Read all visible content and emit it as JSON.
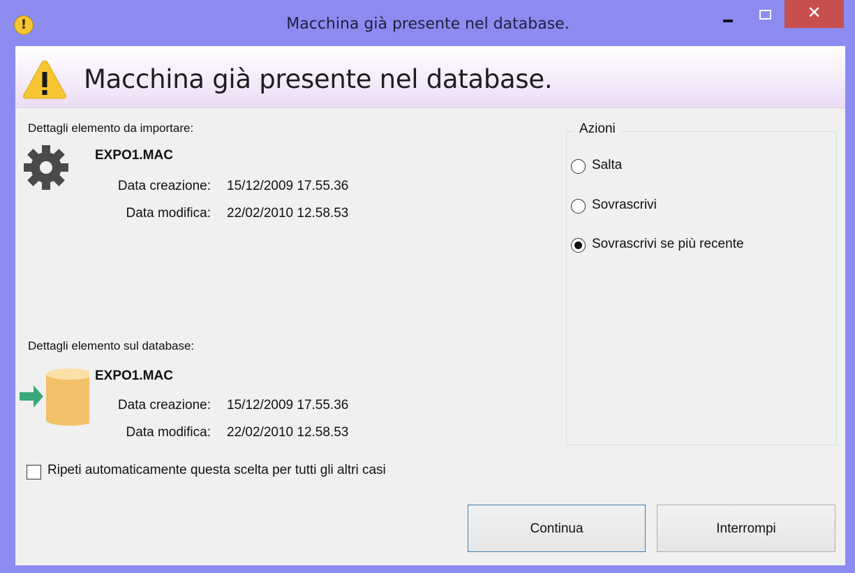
{
  "window": {
    "title": "Macchina già presente nel database.",
    "title_icon": "warning-circle-icon",
    "accent_color": "#8b8bf0",
    "close_color": "#c7504f"
  },
  "banner": {
    "title": "Macchina già presente nel database.",
    "icon": "warning-triangle-icon"
  },
  "import_section": {
    "label": "Dettagli elemento da importare:",
    "icon": "gear-icon",
    "name": "EXPO1.MAC",
    "created_label": "Data creazione:",
    "created_value": "15/12/2009 17.55.36",
    "modified_label": "Data modifica:",
    "modified_value": "22/02/2010 12.58.53"
  },
  "database_section": {
    "label": "Dettagli elemento sul database:",
    "icon": "database-import-icon",
    "name": "EXPO1.MAC",
    "created_label": "Data creazione:",
    "created_value": "15/12/2009 17.55.36",
    "modified_label": "Data modifica:",
    "modified_value": "22/02/2010 12.58.53"
  },
  "actions": {
    "legend": "Azioni",
    "options": [
      {
        "label": "Salta",
        "checked": false
      },
      {
        "label": "Sovrascrivi",
        "checked": false
      },
      {
        "label": "Sovrascrivi se più recente",
        "checked": true
      }
    ]
  },
  "repeat_checkbox": {
    "label": "Ripeti automaticamente questa scelta per tutti gli altri casi",
    "checked": false
  },
  "buttons": {
    "continue": "Continua",
    "abort": "Interrompi"
  }
}
